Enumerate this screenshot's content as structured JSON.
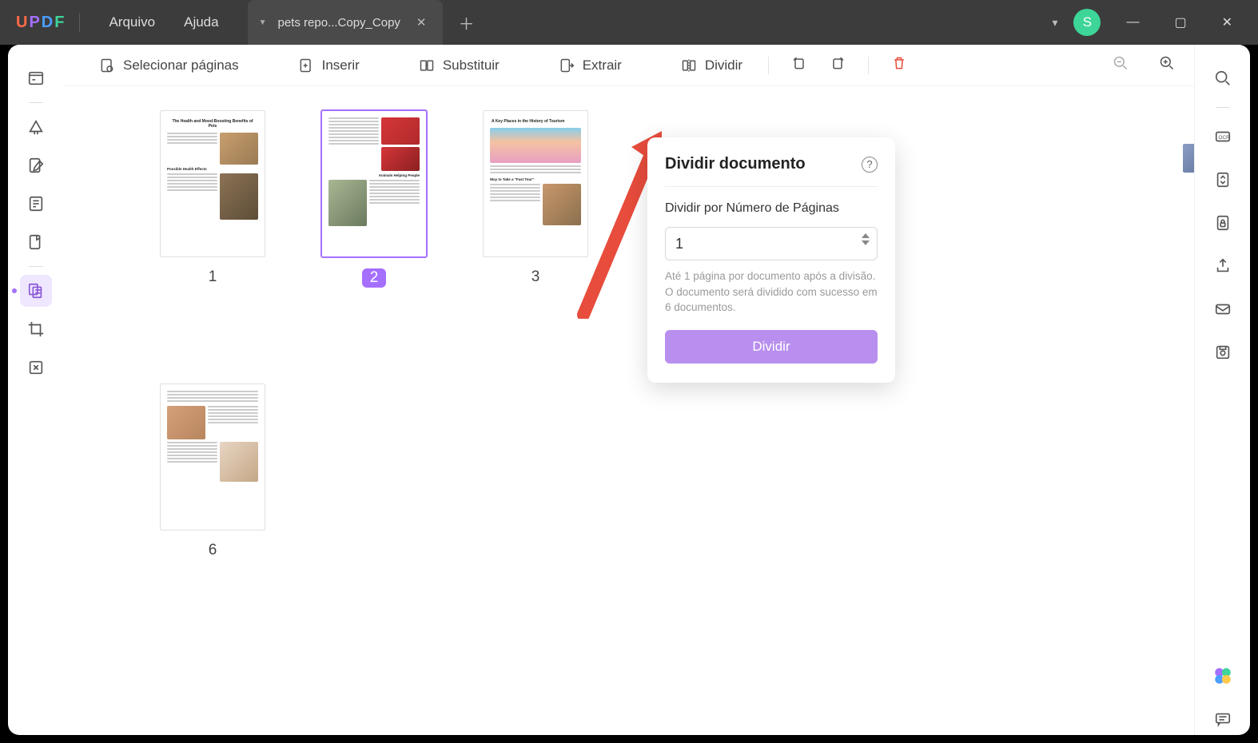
{
  "titlebar": {
    "menu_file": "Arquivo",
    "menu_help": "Ajuda",
    "tab_name": "pets repo...Copy_Copy",
    "avatar_letter": "S"
  },
  "toolbar": {
    "select_pages": "Selecionar páginas",
    "insert": "Inserir",
    "replace": "Substituir",
    "extract": "Extrair",
    "split": "Dividir"
  },
  "pages": {
    "p1": {
      "num": "1",
      "title": "The Health and Mood-Boosting Benefits of Pets"
    },
    "p2": {
      "num": "2",
      "title": "Animals Helping People"
    },
    "p3": {
      "num": "3",
      "title": "A Key Places in the History of Tourism"
    },
    "p6": {
      "num": "6",
      "title": ""
    }
  },
  "popup": {
    "title": "Dividir documento",
    "label": "Dividir por Número de Páginas",
    "value": "1",
    "hint": "Até 1 página por documento após a divisão. O documento será dividido com sucesso em 6 documentos.",
    "button": "Dividir"
  }
}
